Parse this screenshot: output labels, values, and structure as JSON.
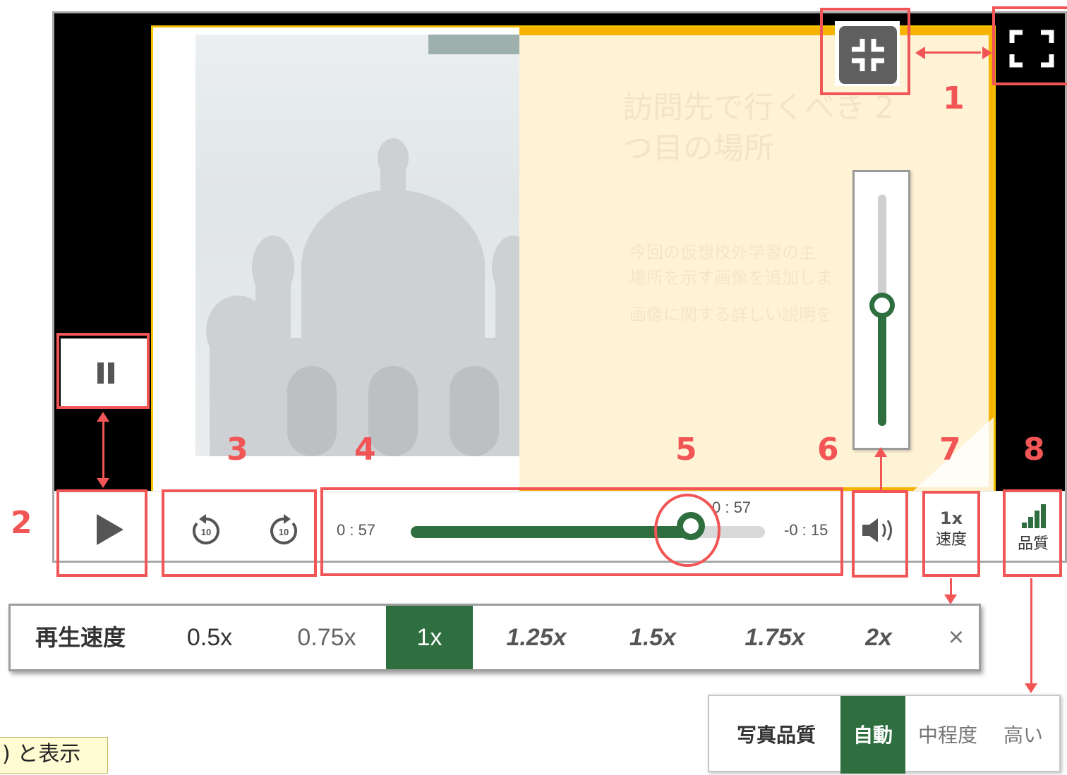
{
  "slide": {
    "title": "訪問先で行くべき 2 つ目の場所",
    "body_line1": "今回の仮想校外学習の主",
    "body_line2": "場所を示す画像を追加しま",
    "body_line3": "画像に関する詳しい説明を"
  },
  "controls": {
    "elapsed": "0 : 57",
    "tooltip_time": "0 : 57",
    "remaining": "-0 : 15",
    "progress_fraction": 0.79,
    "volume_fraction": 0.52,
    "speed_value": "1x",
    "speed_label": "速度",
    "quality_label": "品質"
  },
  "icons": {
    "exit_fullscreen": "exit-fullscreen-icon",
    "fullscreen": "fullscreen-icon",
    "pause": "pause-icon",
    "play": "play-icon",
    "rewind10": "rewind-10-icon",
    "forward10": "forward-10-icon",
    "rewind10_text": "10",
    "forward10_text": "10",
    "volume": "speaker-icon",
    "quality": "signal-bars-icon",
    "close": "close-icon"
  },
  "annotations": {
    "n1": "1",
    "n2": "2",
    "n3": "3",
    "n4": "4",
    "n5": "5",
    "n6": "6",
    "n7": "7",
    "n8": "8",
    "color": "#f25556"
  },
  "speed_menu": {
    "label": "再生速度",
    "options": [
      "0.5x",
      "0.75x",
      "1x",
      "1.25x",
      "1.5x",
      "1.75x",
      "2x"
    ],
    "selected": "1x",
    "close": "×"
  },
  "quality_menu": {
    "label": "写真品質",
    "options": [
      "自動",
      "中程度",
      "高い"
    ],
    "selected": "自動"
  },
  "caption": ") と表示",
  "colors": {
    "accent": "#2e6e3f",
    "slide_yellow": "#f6b400"
  }
}
